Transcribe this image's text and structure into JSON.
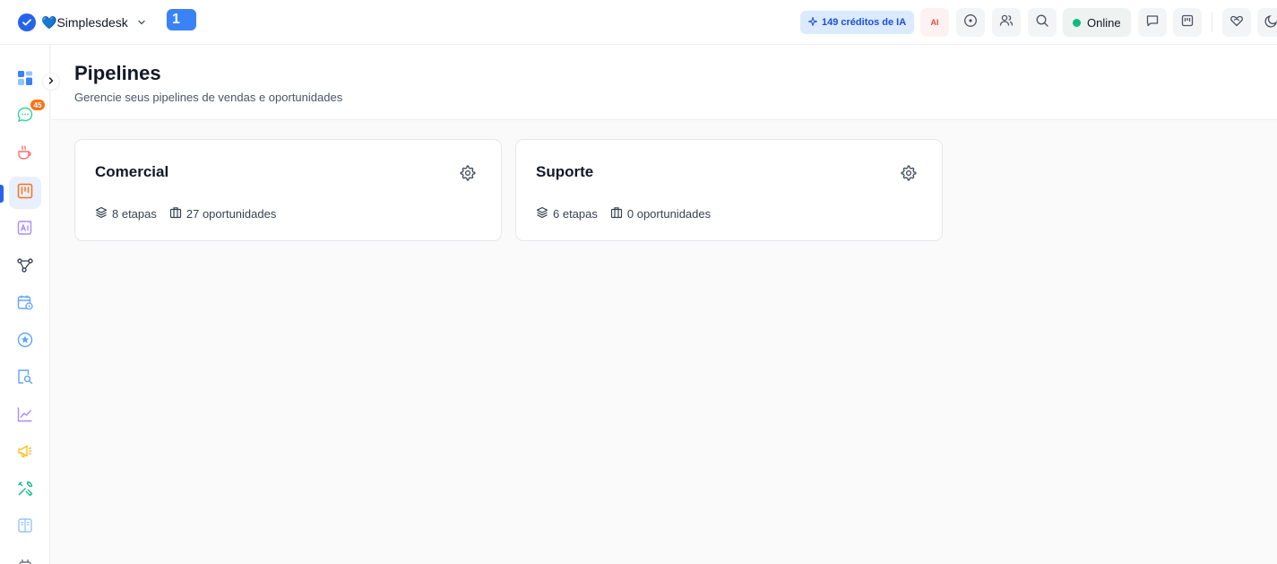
{
  "topbar": {
    "workspace_heart": "💙",
    "workspace_name": "Simplesdesk",
    "number_badge": "1",
    "credits_label": "149 créditos de IA",
    "ai_label": "AI",
    "status_label": "Online"
  },
  "sidebar": {
    "notification_count": "45",
    "items": [
      "dashboard-icon",
      "chat-icon",
      "coffee-icon",
      "kanban-icon",
      "ai-contact-icon",
      "flow-icon",
      "calendar-icon",
      "star-icon",
      "search-doc-icon",
      "chart-icon",
      "megaphone-icon",
      "tools-icon",
      "book-icon"
    ]
  },
  "page": {
    "title": "Pipelines",
    "subtitle": "Gerencie seus pipelines de vendas e oportunidades"
  },
  "pipelines": [
    {
      "name": "Comercial",
      "stages": "8 etapas",
      "opportunities": "27 oportunidades"
    },
    {
      "name": "Suporte",
      "stages": "6 etapas",
      "opportunities": "0 oportunidades"
    }
  ],
  "colors": {
    "brand": "#2563eb",
    "online": "#10b981",
    "badge": "#f97316"
  }
}
